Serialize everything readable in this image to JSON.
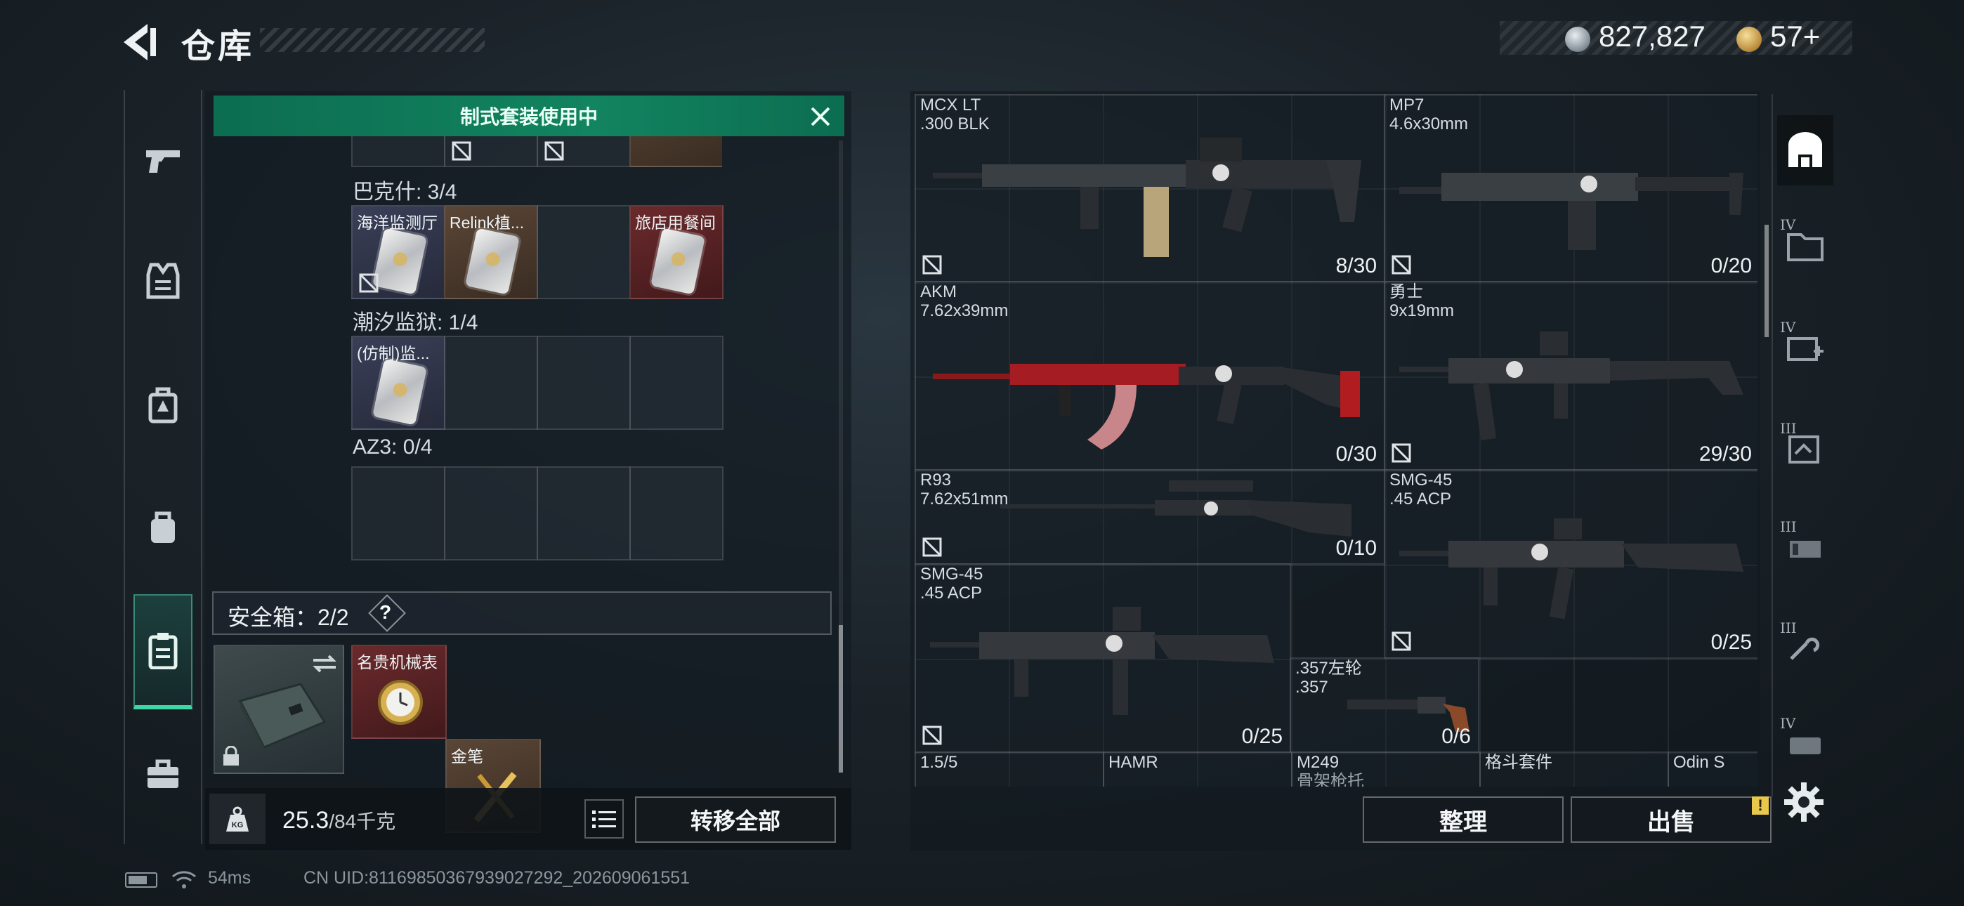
{
  "header": {
    "title": "仓库",
    "currencies": [
      {
        "name": "silver-coin",
        "value": "827,827"
      },
      {
        "name": "gold-coin",
        "value": "57+"
      }
    ]
  },
  "left_tabs": [
    {
      "icon": "pistol-icon",
      "active": false
    },
    {
      "icon": "armor-vest-icon",
      "active": false
    },
    {
      "icon": "chest-rig-icon",
      "active": false
    },
    {
      "icon": "backpack-icon",
      "active": false
    },
    {
      "icon": "clipboard-icon",
      "active": true
    },
    {
      "icon": "toolbox-icon",
      "active": false
    }
  ],
  "banner": {
    "text": "制式套装使用中"
  },
  "key_groups": [
    {
      "label": "巴克什: 3/4",
      "cells": [
        {
          "name": "海洋监测厅",
          "tone": "blue",
          "locked": true
        },
        {
          "name": "Relink植...",
          "tone": "brown",
          "locked": false
        },
        {
          "name": "",
          "tone": "empty",
          "locked": false
        },
        {
          "name": "旅店用餐间",
          "tone": "red",
          "locked": false
        }
      ]
    },
    {
      "label": "潮汐监狱: 1/4",
      "cells": [
        {
          "name": "(仿制)监...",
          "tone": "blue",
          "locked": false
        },
        {
          "name": "",
          "tone": "empty",
          "locked": false
        },
        {
          "name": "",
          "tone": "empty",
          "locked": false
        },
        {
          "name": "",
          "tone": "empty",
          "locked": false
        }
      ]
    },
    {
      "label": "AZ3: 0/4",
      "cells": [
        {
          "name": "",
          "tone": "empty",
          "locked": false
        },
        {
          "name": "",
          "tone": "empty",
          "locked": false
        },
        {
          "name": "",
          "tone": "empty",
          "locked": false
        },
        {
          "name": "",
          "tone": "empty",
          "locked": false
        }
      ]
    }
  ],
  "safe_box": {
    "label": "安全箱：2/2",
    "help": "?",
    "items": [
      {
        "name": "名贵机械表",
        "tone": "red"
      },
      {
        "name": "金笔",
        "tone": "brown"
      }
    ]
  },
  "footer_left": {
    "weight": "25.3",
    "capacity": "/84千克",
    "transfer_label": "转移全部"
  },
  "weapons": [
    {
      "name": "MCX LT",
      "caliber": ".300 BLK",
      "ammo": "8/30"
    },
    {
      "name": "MP7",
      "caliber": "4.6x30mm",
      "ammo": "0/20"
    },
    {
      "name": "AKM",
      "caliber": "7.62x39mm",
      "ammo": "0/30"
    },
    {
      "name": "勇士",
      "caliber": "9x19mm",
      "ammo": "29/30"
    },
    {
      "name": "R93",
      "caliber": "7.62x51mm",
      "ammo": "0/10"
    },
    {
      "name": "SMG-45",
      "caliber": ".45 ACP",
      "ammo": "0/25"
    },
    {
      "name": "SMG-45",
      "caliber": ".45 ACP",
      "ammo": "0/25"
    },
    {
      "name": ".357左轮",
      "caliber": ".357",
      "ammo": "0/6"
    }
  ],
  "attachments_row": [
    {
      "name": "1.5/5",
      "sub": ""
    },
    {
      "name": "HAMR",
      "sub": ""
    },
    {
      "name": "M249",
      "sub": "骨架枪托"
    },
    {
      "name": "格斗套件",
      "sub": ""
    },
    {
      "name": "Odin S",
      "sub": ""
    }
  ],
  "footer_right": {
    "sort_label": "整理",
    "sell_label": "出售",
    "sell_badge": "!"
  },
  "filters": [
    {
      "level": "",
      "icon": "all-items-icon",
      "active": true
    },
    {
      "level": "IV",
      "icon": "folder-icon"
    },
    {
      "level": "IV",
      "icon": "medkit-icon"
    },
    {
      "level": "III",
      "icon": "document-icon"
    },
    {
      "level": "III",
      "icon": "ammo-icon"
    },
    {
      "level": "III",
      "icon": "tools-icon"
    },
    {
      "level": "IV",
      "icon": "misc-icon"
    }
  ],
  "status_bar": {
    "ping": "54ms",
    "uid": "CN UID:81169850367939027292_202609061551"
  },
  "colors": {
    "accent_green": "#12845f",
    "active_tab_line": "#3fd6a6",
    "badge_yellow": "#e8c84a"
  }
}
